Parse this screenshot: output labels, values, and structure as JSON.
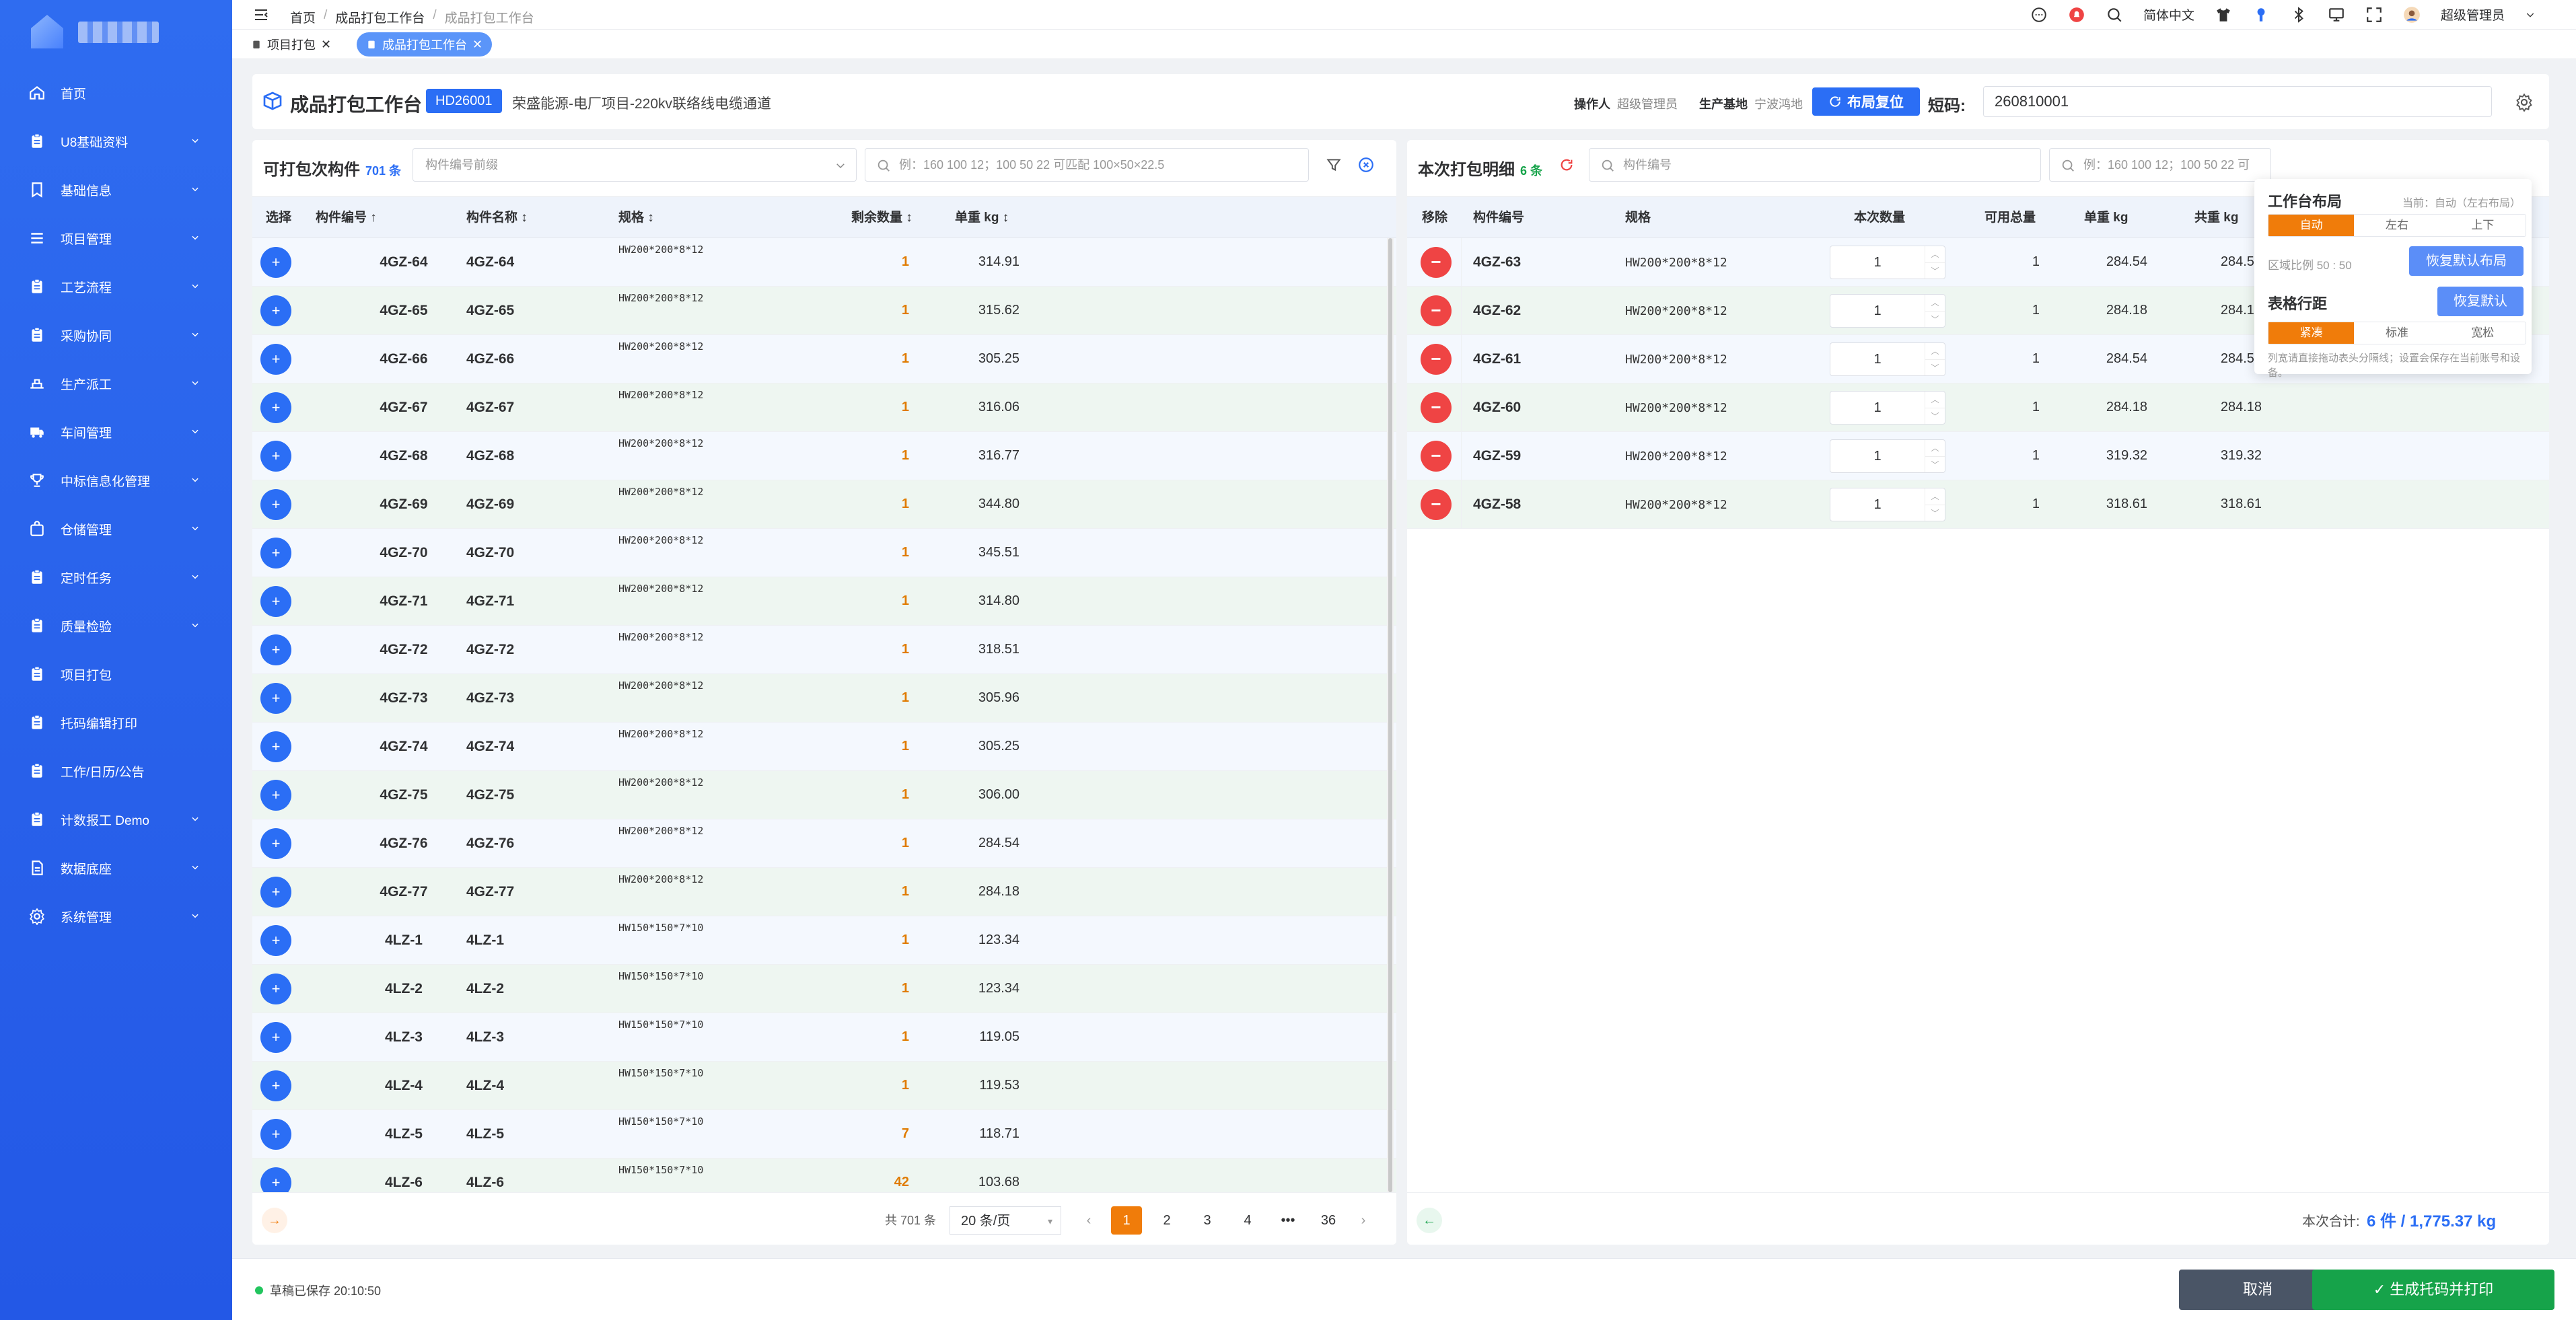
{
  "sidebar": {
    "items": [
      {
        "label": "首页",
        "icon": "home-icon",
        "expand": false
      },
      {
        "label": "U8基础资料",
        "icon": "clipboard-icon",
        "expand": true
      },
      {
        "label": "基础信息",
        "icon": "bookmark-icon",
        "expand": true
      },
      {
        "label": "项目管理",
        "icon": "list-icon",
        "expand": true
      },
      {
        "label": "工艺流程",
        "icon": "clipboard-icon",
        "expand": true
      },
      {
        "label": "采购协同",
        "icon": "clipboard-icon",
        "expand": true
      },
      {
        "label": "生产派工",
        "icon": "dispatch-icon",
        "expand": true
      },
      {
        "label": "车间管理",
        "icon": "truck-icon",
        "expand": true
      },
      {
        "label": "中标信息化管理",
        "icon": "trophy-icon",
        "expand": true
      },
      {
        "label": "仓储管理",
        "icon": "bag-icon",
        "expand": true
      },
      {
        "label": "定时任务",
        "icon": "clipboard-icon",
        "expand": true
      },
      {
        "label": "质量检验",
        "icon": "clipboard-icon",
        "expand": true
      },
      {
        "label": "项目打包",
        "icon": "clipboard-icon",
        "expand": false
      },
      {
        "label": "托码编辑打印",
        "icon": "clipboard-icon",
        "expand": false
      },
      {
        "label": "工作/日历/公告",
        "icon": "clipboard-icon",
        "expand": false
      },
      {
        "label": "计数报工 Demo",
        "icon": "clipboard-icon",
        "expand": true
      },
      {
        "label": "数据底座",
        "icon": "document-icon",
        "expand": true
      },
      {
        "label": "系统管理",
        "icon": "gear-icon",
        "expand": true
      }
    ]
  },
  "topbar": {
    "breadcrumb": [
      "首页",
      "成品打包工作台",
      "成品打包工作台"
    ],
    "language": "简体中文",
    "user": "超级管理员"
  },
  "tabs": [
    {
      "label": "项目打包",
      "active": false
    },
    {
      "label": "成品打包工作台",
      "active": true
    }
  ],
  "header": {
    "title": "成品打包工作台",
    "badge": "HD26001",
    "project": "荣盛能源-电厂项目-220kv联络线电缆通道",
    "operator_label": "操作人",
    "operator": "超级管理员",
    "base_label": "生产基地",
    "base": "宁波鸿地",
    "reset_label": "布局复位",
    "shortcode_label": "短码:",
    "shortcode": "260810001"
  },
  "left": {
    "title": "可打包次构件",
    "count": "701 条",
    "prefix_placeholder": "构件编号前缀",
    "search_placeholder": "例：160 100 12；100 50 22 可匹配 100×50×22.5",
    "columns": [
      "选择",
      "构件编号 ↑",
      "构件名称 ↕",
      "规格 ↕",
      "剩余数量 ↕",
      "单重 kg ↕"
    ],
    "rows": [
      {
        "code": "4GZ-64",
        "name": "4GZ-64",
        "spec": "HW200*200*8*12",
        "qty": "1",
        "weight": "314.91"
      },
      {
        "code": "4GZ-65",
        "name": "4GZ-65",
        "spec": "HW200*200*8*12",
        "qty": "1",
        "weight": "315.62"
      },
      {
        "code": "4GZ-66",
        "name": "4GZ-66",
        "spec": "HW200*200*8*12",
        "qty": "1",
        "weight": "305.25"
      },
      {
        "code": "4GZ-67",
        "name": "4GZ-67",
        "spec": "HW200*200*8*12",
        "qty": "1",
        "weight": "316.06"
      },
      {
        "code": "4GZ-68",
        "name": "4GZ-68",
        "spec": "HW200*200*8*12",
        "qty": "1",
        "weight": "316.77"
      },
      {
        "code": "4GZ-69",
        "name": "4GZ-69",
        "spec": "HW200*200*8*12",
        "qty": "1",
        "weight": "344.80"
      },
      {
        "code": "4GZ-70",
        "name": "4GZ-70",
        "spec": "HW200*200*8*12",
        "qty": "1",
        "weight": "345.51"
      },
      {
        "code": "4GZ-71",
        "name": "4GZ-71",
        "spec": "HW200*200*8*12",
        "qty": "1",
        "weight": "314.80"
      },
      {
        "code": "4GZ-72",
        "name": "4GZ-72",
        "spec": "HW200*200*8*12",
        "qty": "1",
        "weight": "318.51"
      },
      {
        "code": "4GZ-73",
        "name": "4GZ-73",
        "spec": "HW200*200*8*12",
        "qty": "1",
        "weight": "305.96"
      },
      {
        "code": "4GZ-74",
        "name": "4GZ-74",
        "spec": "HW200*200*8*12",
        "qty": "1",
        "weight": "305.25"
      },
      {
        "code": "4GZ-75",
        "name": "4GZ-75",
        "spec": "HW200*200*8*12",
        "qty": "1",
        "weight": "306.00"
      },
      {
        "code": "4GZ-76",
        "name": "4GZ-76",
        "spec": "HW200*200*8*12",
        "qty": "1",
        "weight": "284.54"
      },
      {
        "code": "4GZ-77",
        "name": "4GZ-77",
        "spec": "HW200*200*8*12",
        "qty": "1",
        "weight": "284.18"
      },
      {
        "code": "4LZ-1",
        "name": "4LZ-1",
        "spec": "HW150*150*7*10",
        "qty": "1",
        "weight": "123.34"
      },
      {
        "code": "4LZ-2",
        "name": "4LZ-2",
        "spec": "HW150*150*7*10",
        "qty": "1",
        "weight": "123.34"
      },
      {
        "code": "4LZ-3",
        "name": "4LZ-3",
        "spec": "HW150*150*7*10",
        "qty": "1",
        "weight": "119.05"
      },
      {
        "code": "4LZ-4",
        "name": "4LZ-4",
        "spec": "HW150*150*7*10",
        "qty": "1",
        "weight": "119.53"
      },
      {
        "code": "4LZ-5",
        "name": "4LZ-5",
        "spec": "HW150*150*7*10",
        "qty": "7",
        "weight": "118.71"
      },
      {
        "code": "4LZ-6",
        "name": "4LZ-6",
        "spec": "HW150*150*7*10",
        "qty": "42",
        "weight": "103.68"
      }
    ],
    "pagination": {
      "total": "共 701 条",
      "page_size": "20 条/页",
      "pages": [
        "1",
        "2",
        "3",
        "4",
        "•••",
        "36"
      ]
    }
  },
  "right": {
    "title": "本次打包明细",
    "count": "6 条",
    "code_placeholder": "构件编号",
    "search_placeholder": "例：160 100 12；100 50 22 可",
    "columns": [
      "移除",
      "构件编号",
      "规格",
      "本次数量",
      "可用总量",
      "单重 kg",
      "共重 kg"
    ],
    "rows": [
      {
        "code": "4GZ-63",
        "spec": "HW200*200*8*12",
        "qty": "1",
        "avail": "1",
        "weight": "284.54",
        "total": "284.54"
      },
      {
        "code": "4GZ-62",
        "spec": "HW200*200*8*12",
        "qty": "1",
        "avail": "1",
        "weight": "284.18",
        "total": "284.18"
      },
      {
        "code": "4GZ-61",
        "spec": "HW200*200*8*12",
        "qty": "1",
        "avail": "1",
        "weight": "284.54",
        "total": "284.54"
      },
      {
        "code": "4GZ-60",
        "spec": "HW200*200*8*12",
        "qty": "1",
        "avail": "1",
        "weight": "284.18",
        "total": "284.18"
      },
      {
        "code": "4GZ-59",
        "spec": "HW200*200*8*12",
        "qty": "1",
        "avail": "1",
        "weight": "319.32",
        "total": "319.32"
      },
      {
        "code": "4GZ-58",
        "spec": "HW200*200*8*12",
        "qty": "1",
        "avail": "1",
        "weight": "318.61",
        "total": "318.61"
      }
    ],
    "summary_label": "本次合计:",
    "summary_value": "6 件 / 1,775.37 kg"
  },
  "popover": {
    "layout_title": "工作台布局",
    "layout_current": "当前：自动（左右布局）",
    "layout_options": [
      "自动",
      "左右",
      "上下"
    ],
    "ratio": "区域比例 50 : 50",
    "restore_layout": "恢复默认布局",
    "spacing_title": "表格行距",
    "restore_default": "恢复默认",
    "spacing_options": [
      "紧凑",
      "标准",
      "宽松"
    ],
    "hint": "列宽请直接拖动表头分隔线；设置会保存在当前账号和设备。"
  },
  "footer": {
    "saved": "草稿已保存 20:10:50",
    "cancel": "取消",
    "generate": "✓ 生成托码并打印"
  },
  "colors": {
    "primary": "#2b6ef5",
    "accent": "#f07c0a",
    "danger": "#ef4444",
    "success": "#16a34a",
    "sidebar": "#2f6cf0"
  }
}
